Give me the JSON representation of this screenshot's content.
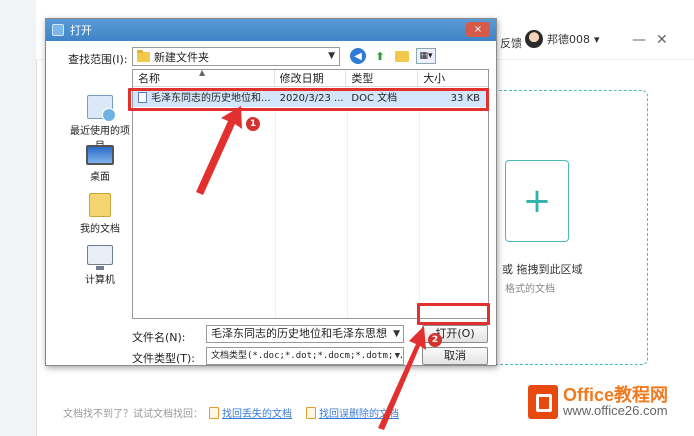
{
  "background": {
    "feedback": "反馈",
    "username": "邦德008",
    "drop_text": "或 拖拽到此区域",
    "format_text": "格式的文档",
    "footer_prompt": "文档找不到了？试试文档找回：",
    "recover_lost": "找回丢失的文档",
    "recover_deleted": "找回误删除的文档"
  },
  "logo": {
    "brand": "Office教程网",
    "url": "www.office26.com"
  },
  "dialog": {
    "title": "打开",
    "close_glyph": "×",
    "look_in_label": "查找范围(I):",
    "look_in_value": "新建文件夹",
    "places": [
      {
        "label": "最近使用的项目",
        "icon": "recent-icon"
      },
      {
        "label": "桌面",
        "icon": "desktop-icon"
      },
      {
        "label": "我的文档",
        "icon": "documents-icon"
      },
      {
        "label": "计算机",
        "icon": "computer-icon"
      }
    ],
    "columns": {
      "name": "名称",
      "date": "修改日期",
      "type": "类型",
      "size": "大小"
    },
    "files": [
      {
        "name": "毛泽东同志的历史地位和...",
        "date": "2020/3/23 ...",
        "type": "DOC 文档",
        "size": "33 KB"
      }
    ],
    "filename_label": "文件名(N):",
    "filename_value": "毛泽东同志的历史地位和毛泽东思想",
    "filetype_label": "文件类型(T):",
    "filetype_value": "文档类型(*.doc;*.dot;*.docm;*.dotm;*.",
    "open_button": "打开(O)",
    "cancel_button": "取消"
  },
  "annotations": {
    "badge1": "1",
    "badge2": "2",
    "color": "#e2302f"
  },
  "colors": {
    "title_bar": "#3e84c8",
    "accent_teal": "#49bdb8",
    "logo_orange": "#e8490f"
  }
}
